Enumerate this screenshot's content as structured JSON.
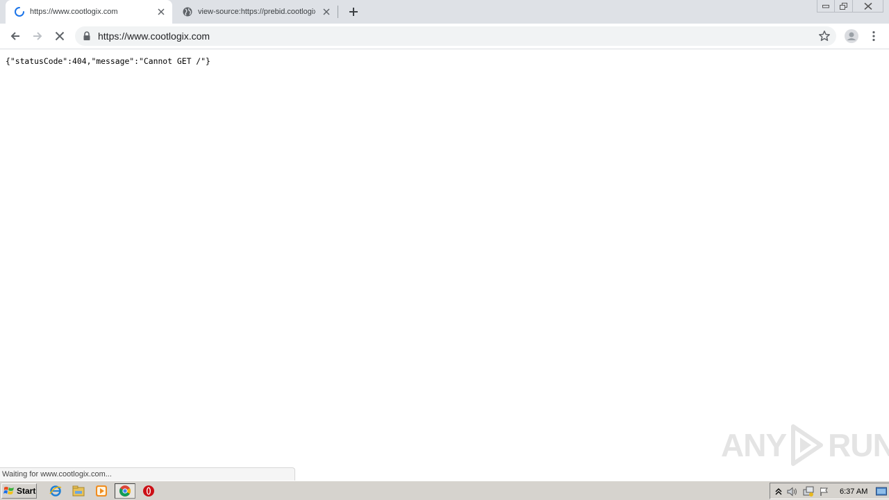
{
  "browser": {
    "tabs": [
      {
        "title": "https://www.cootlogix.com",
        "icon": "loading-spinner-icon",
        "active": true
      },
      {
        "title": "view-source:https://prebid.cootlogix",
        "icon": "globe-icon",
        "active": false
      }
    ],
    "address": "https://www.cootlogix.com",
    "status_text": "Waiting for www.cootlogix.com..."
  },
  "page": {
    "body_text": "{\"statusCode\":404,\"message\":\"Cannot GET /\"}"
  },
  "watermark": {
    "left": "ANY",
    "right": "RUN"
  },
  "taskbar": {
    "start_label": "Start",
    "clock": "6:37 AM",
    "apps": [
      "ie-icon",
      "explorer-icon",
      "media-player-icon",
      "chrome-icon",
      "opera-icon"
    ]
  },
  "colors": {
    "tabstrip": "#dee1e6",
    "omnibox": "#f1f3f4",
    "taskbar": "#d6d3ce",
    "spinner": "#1a73e8"
  }
}
